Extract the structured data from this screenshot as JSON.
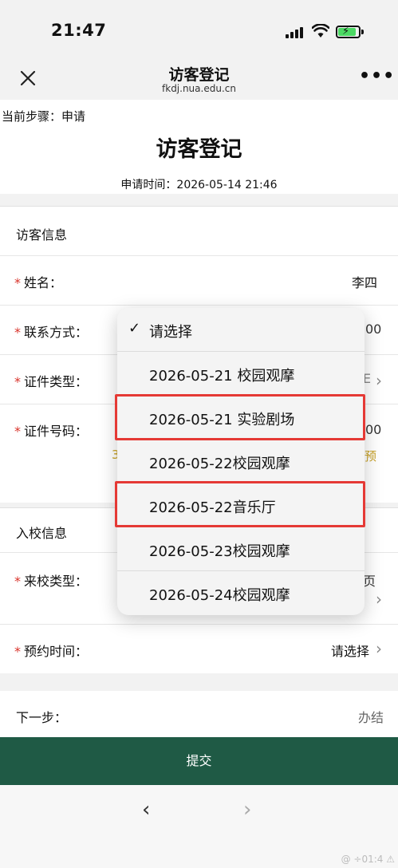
{
  "status_bar": {
    "time": "21:47"
  },
  "nav": {
    "title": "访客登记",
    "subtitle": "fkdj.nua.edu.cn",
    "more": "•••"
  },
  "header": {
    "step": "当前步骤：申请",
    "title": "访客登记",
    "apply_time": "申请时间：2026-05-14 21:46"
  },
  "sections": {
    "visitor_info": "访客信息",
    "entry_info": "入校信息"
  },
  "fields": {
    "name": {
      "label": "姓名：",
      "value": "李四"
    },
    "contact": {
      "label": "联系方式：",
      "peek": "00"
    },
    "id_type": {
      "label": "证件类型：",
      "peek": "E"
    },
    "id_number": {
      "label": "证件号码：",
      "peek": "00",
      "note_left": "3",
      "note_right": "预"
    },
    "visit_type": {
      "label": "来校类型：",
      "peek": "页"
    },
    "reserve_time": {
      "label": "预约时间：",
      "value": "请选择"
    }
  },
  "next_step": {
    "label": "下一步：",
    "value": "办结"
  },
  "submit": {
    "label": "提交"
  },
  "browser": {
    "back": "‹",
    "forward": "›",
    "watermark": "@ ÷01:4 ⚠"
  },
  "dropdown": {
    "selected_check": "✓",
    "options": [
      "请选择",
      "2026-05-21 校园观摩",
      "2026-05-21 实验剧场",
      "2026-05-22校园观摩",
      "2026-05-22音乐厅",
      "2026-05-23校园观摩",
      "2026-05-24校园观摩"
    ]
  },
  "colors": {
    "accent": "#1f5a45",
    "required": "#d9342b",
    "highlight": "#e53935"
  }
}
